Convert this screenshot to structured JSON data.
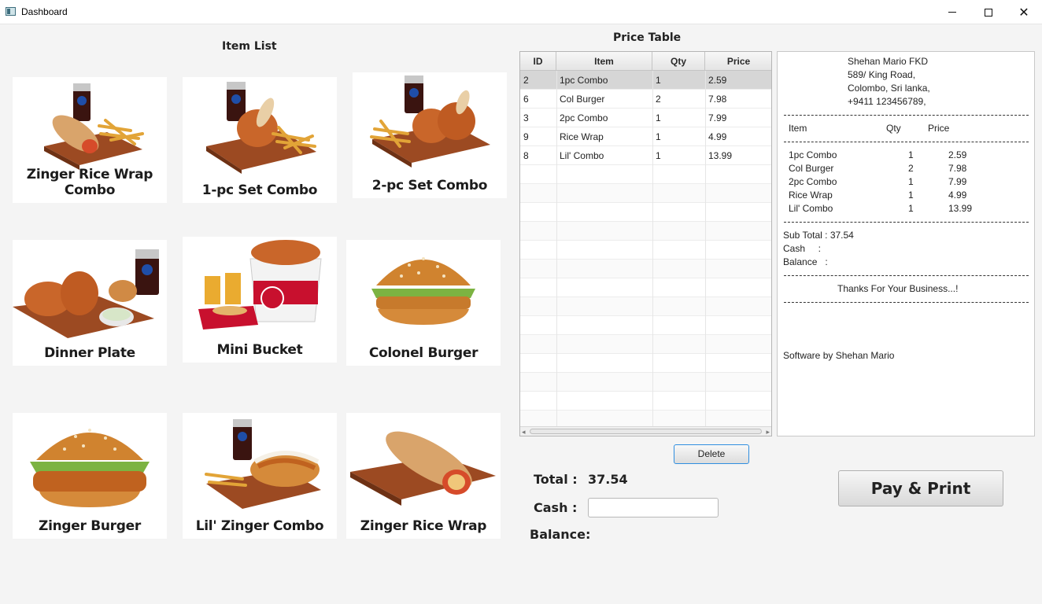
{
  "window": {
    "title": "Dashboard",
    "minimize_icon": "minimize-icon",
    "maximize_icon": "maximize-icon",
    "close_icon": "close-icon"
  },
  "item_list": {
    "title": "Item List",
    "items": [
      {
        "name": "Zinger Rice Wrap Combo",
        "icon": "wrap-combo-image"
      },
      {
        "name": "1-pc Set Combo",
        "icon": "chicken-combo-image"
      },
      {
        "name": "2-pc Set Combo",
        "icon": "chicken-combo-image"
      },
      {
        "name": "Dinner Plate",
        "icon": "dinner-plate-image"
      },
      {
        "name": "Mini Bucket",
        "icon": "bucket-image"
      },
      {
        "name": "Colonel Burger",
        "icon": "burger-image"
      },
      {
        "name": "Zinger Burger",
        "icon": "burger-image"
      },
      {
        "name": "Lil' Zinger Combo",
        "icon": "burger-combo-image"
      },
      {
        "name": "Zinger Rice Wrap",
        "icon": "wrap-image"
      }
    ]
  },
  "price_table": {
    "title": "Price Table",
    "columns": [
      "ID",
      "Item",
      "Qty",
      "Price"
    ],
    "rows": [
      [
        "2",
        "1pc Combo",
        "1",
        "2.59"
      ],
      [
        "6",
        "Col Burger",
        "2",
        "7.98"
      ],
      [
        "3",
        "2pc Combo",
        "1",
        "7.99"
      ],
      [
        "9",
        "Rice Wrap",
        "1",
        "4.99"
      ],
      [
        "8",
        "Lil' Combo",
        "1",
        "13.99"
      ]
    ],
    "selected_row": 0
  },
  "receipt": {
    "header_lines": [
      "Shehan Mario FKD",
      "589/ King Road,",
      "Colombo, Sri lanka,",
      "+9411 123456789,"
    ],
    "col_item": "Item",
    "col_qty": "Qty",
    "col_price": "Price",
    "lines": [
      {
        "item": "1pc Combo",
        "qty": "1",
        "price": "2.59"
      },
      {
        "item": "Col Burger",
        "qty": "2",
        "price": "7.98"
      },
      {
        "item": "2pc Combo",
        "qty": "1",
        "price": "7.99"
      },
      {
        "item": "Rice Wrap",
        "qty": "1",
        "price": "4.99"
      },
      {
        "item": "Lil' Combo",
        "qty": "1",
        "price": "13.99"
      }
    ],
    "subtotal": "Sub Total : 37.54",
    "cash": "Cash     :",
    "balance": "Balance   :",
    "thanks": "Thanks For Your Business...!",
    "footer": "Software by Shehan Mario"
  },
  "controls": {
    "delete_label": "Delete",
    "total_label": "Total :",
    "total_value": "37.54",
    "cash_label": "Cash :",
    "cash_value": "",
    "balance_label": "Balance:",
    "pay_label": "Pay & Print"
  },
  "colors": {
    "accent_border": "#2f8ee0",
    "selected_row": "#d6d6d6",
    "background": "#f4f4f4"
  }
}
